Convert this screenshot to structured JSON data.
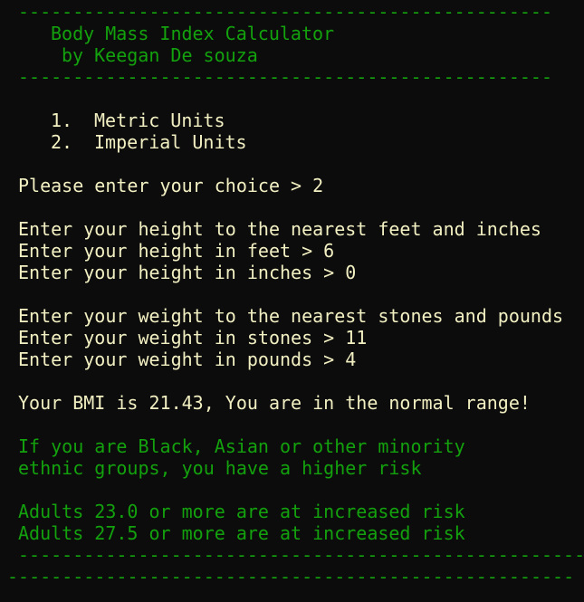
{
  "rules": {
    "top": "-------------------------------------------------",
    "header_bottom": "-------------------------------------------------",
    "footer_1": "------------------------------------------------------",
    "footer_2": "----------------------------------------------------"
  },
  "header": {
    "title": "Body Mass Index Calculator",
    "author": "by Keegan De souza"
  },
  "menu": {
    "options": [
      {
        "number": "1.",
        "label": "Metric Units"
      },
      {
        "number": "2.",
        "label": "Imperial Units"
      }
    ]
  },
  "prompts": {
    "choice": "Please enter your choice > 2",
    "height_intro": "Enter your height to the nearest feet and inches",
    "height_feet": "Enter your height in feet > 6",
    "height_inches": "Enter your height in inches > 0",
    "weight_intro": "Enter your weight to the nearest stones and pounds",
    "weight_stones": "Enter your weight in stones > 11",
    "weight_pounds": "Enter your weight in pounds > 4"
  },
  "result": {
    "text": "Your BMI is 21.43, You are in the normal range!"
  },
  "advice": {
    "line1": "If you are Black, Asian or other minority",
    "line2": "ethnic groups, you have a higher risk",
    "line3": "Adults 23.0 or more are at increased risk",
    "line4": "Adults 27.5 or more are at increased risk"
  },
  "colors": {
    "background": "#0c0c0c",
    "green": "#13a10e",
    "cream": "#f2f0c2"
  }
}
